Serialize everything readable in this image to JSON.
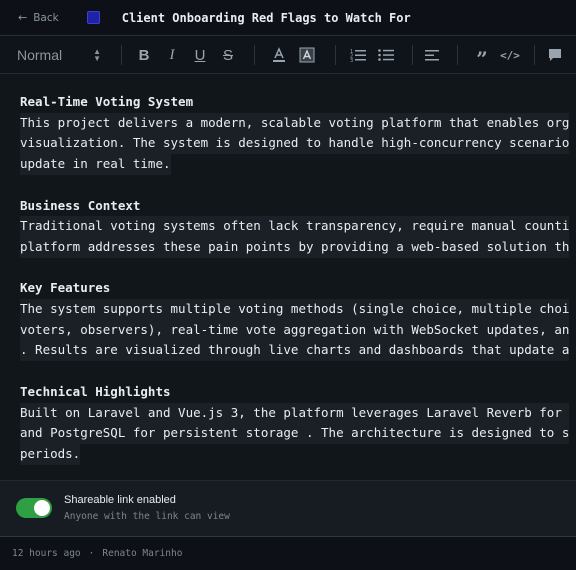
{
  "header": {
    "back_label": "Back",
    "title": "Client Onboarding Red Flags to Watch For",
    "swatch_color": "#1d22a8"
  },
  "toolbar": {
    "block_style": "Normal",
    "buttons": [
      "bold-icon",
      "italic-icon",
      "underline-icon",
      "strikethrough-icon",
      "text-color-icon",
      "highlight-icon",
      "ordered-list-icon",
      "bullet-list-icon",
      "align-icon",
      "quote-icon",
      "code-icon",
      "comment-icon"
    ]
  },
  "document": {
    "sections": [
      {
        "heading": "Real-Time Voting System",
        "lines": [
          "This project delivers a modern, scalable voting platform that enables org",
          "visualization. The system is designed to handle high-concurrency scenario",
          "update in real time."
        ]
      },
      {
        "heading": "Business Context",
        "lines": [
          "Traditional voting systems often lack transparency, require manual counti",
          "platform addresses these pain points by providing a web-based solution th"
        ]
      },
      {
        "heading": "Key Features",
        "lines": [
          "The system supports multiple voting methods (single choice, multiple choi",
          "voters, observers), real-time vote aggregation with WebSocket updates, an",
          ". Results are visualized through live charts and dashboards that update a"
        ]
      },
      {
        "heading": "Technical Highlights",
        "lines": [
          "Built on Laravel and Vue.js 3, the platform leverages Laravel Reverb for ",
          "and PostgreSQL for persistent storage . The architecture is designed to s",
          "periods."
        ]
      }
    ]
  },
  "share": {
    "enabled": true,
    "title": "Shareable link enabled",
    "subtitle": "Anyone with the link can view",
    "toggle_color": "#2ea043"
  },
  "footer": {
    "time": "12 hours ago",
    "separator": "·",
    "author": "Renato Marinho"
  }
}
